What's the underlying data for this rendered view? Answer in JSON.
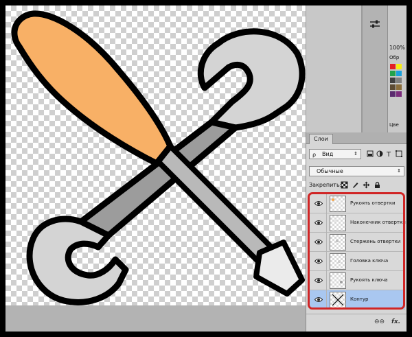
{
  "swatches_panel": {
    "zoom": "100%",
    "mode": "Обр",
    "bottom": "Цве",
    "colors": [
      "#e41e26",
      "#f7ec15",
      "#22a24b",
      "#1aa0dc",
      "#3f3f3f",
      "#7f7f7f",
      "#5b4a33",
      "#8a6d3b",
      "#5a2a6e",
      "#7b2c7c"
    ]
  },
  "layers_panel": {
    "tab_label": "Слои",
    "filter": {
      "search_glyph": "ρ",
      "value": "Вид",
      "arrow": "⇕"
    },
    "blend": {
      "value": "Обычные",
      "arrow": "⇕"
    },
    "lock": {
      "label": "Закрепить:"
    },
    "layers": [
      {
        "name": "Рукоять отвертки",
        "selected": false,
        "thumb_color": "#f7a84f"
      },
      {
        "name": "Наконечник отвертки",
        "selected": false,
        "thumb_color": "#e8e8e8"
      },
      {
        "name": "Стержень отвертки",
        "selected": false,
        "thumb_color": "#bfbfbf"
      },
      {
        "name": "Головка ключа",
        "selected": false,
        "thumb_color": "#cfcfcf"
      },
      {
        "name": "Рукоять ключа",
        "selected": false,
        "thumb_color": "#9e9e9e"
      },
      {
        "name": "Контур",
        "selected": true,
        "thumb_color": "#000000"
      }
    ],
    "bottom_buttons": {
      "link": "⊖⊖",
      "fx": "fx."
    }
  },
  "colors": {
    "handle_orange": "#f8b066",
    "wrench_light": "#d4d4d4",
    "wrench_dark": "#9c9c9c",
    "shaft": "#b9b9b9",
    "tip": "#ebebeb",
    "selection_blue": "#a9c7f0",
    "highlight_red": "#d02525"
  }
}
